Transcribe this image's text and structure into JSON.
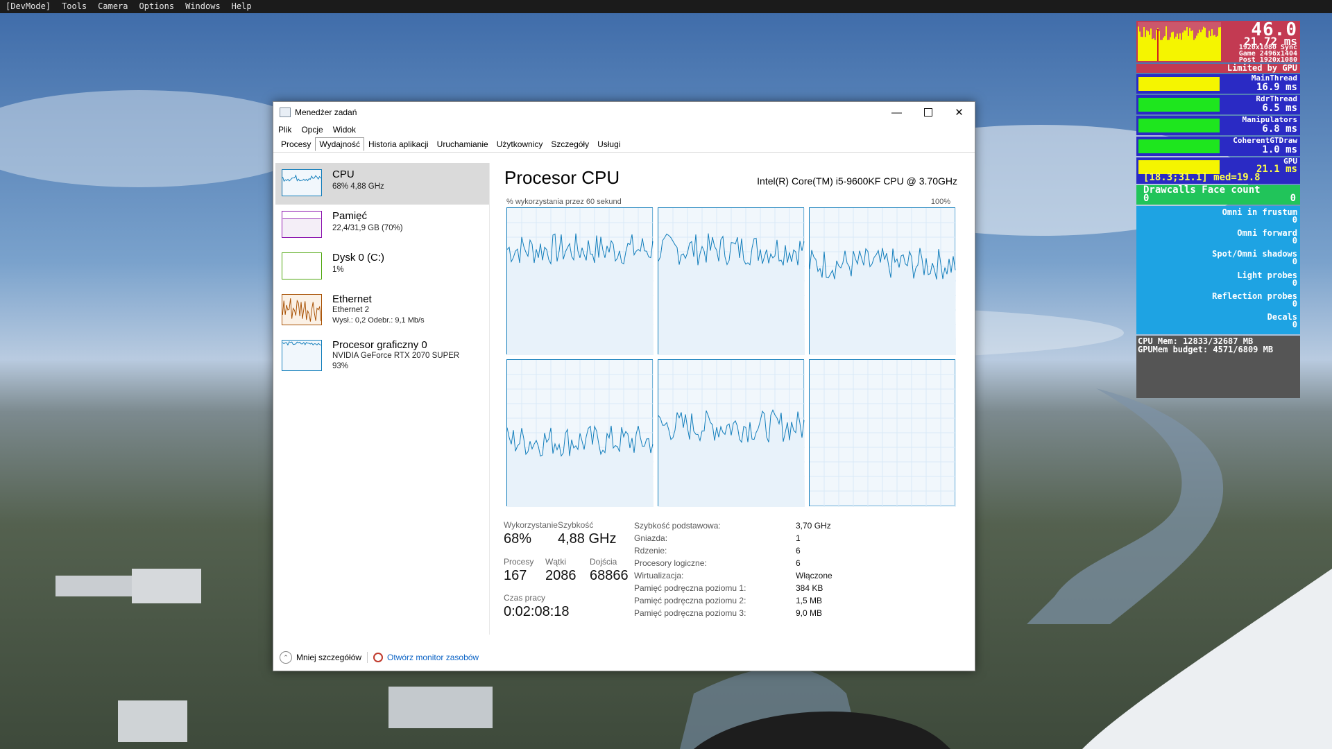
{
  "devmode_menu": [
    "[DevMode]",
    "Tools",
    "Camera",
    "Options",
    "Windows",
    "Help"
  ],
  "overlay": {
    "fps": "46.0",
    "frame_ms": "21.72 ms",
    "lines": [
      "1920x1080 Sync",
      "Game 2496x1404",
      "Post 1920x1080"
    ],
    "limited": "Limited by GPU",
    "threads": [
      {
        "name": "MainThread",
        "value": "16.9 ms",
        "fill": 1.0
      },
      {
        "name": "RdrThread",
        "value": "6.5 ms",
        "fill": 1.0
      },
      {
        "name": "Manipulators",
        "value": "6.8 ms",
        "fill": 1.0
      },
      {
        "name": "CoherentGTDraw",
        "value": "1.0 ms",
        "fill": 1.0
      }
    ],
    "gpu": {
      "name": "GPU",
      "value": "21.1 ms",
      "stats": "[18.3;31.1] med=19.8"
    },
    "drawcalls": {
      "label": "Drawcalls Face count",
      "v1": "0",
      "v2": "0"
    },
    "counters": [
      {
        "name": "Omni in frustum",
        "value": "0"
      },
      {
        "name": "Omni forward",
        "value": "0"
      },
      {
        "name": "Spot/Omni shadows",
        "value": "0"
      },
      {
        "name": "Light probes",
        "value": "0"
      },
      {
        "name": "Reflection probes",
        "value": "0"
      },
      {
        "name": "Decals",
        "value": "0"
      }
    ],
    "mem": [
      "CPU Mem: 12833/32687 MB",
      "GPUMem budget: 4571/6809 MB"
    ]
  },
  "window": {
    "title": "Menedżer zadań",
    "menu": [
      "Plik",
      "Opcje",
      "Widok"
    ],
    "tabs": [
      "Procesy",
      "Wydajność",
      "Historia aplikacji",
      "Uruchamianie",
      "Użytkownicy",
      "Szczegóły",
      "Usługi"
    ],
    "active_tab": "Wydajność",
    "left_items": [
      {
        "name": "CPU",
        "sub1": "68% 4,88 GHz",
        "color": "#117dbb"
      },
      {
        "name": "Pamięć",
        "sub1": "22,4/31,9 GB (70%)",
        "color": "#8b12ae"
      },
      {
        "name": "Dysk 0 (C:)",
        "sub1": "1%",
        "color": "#4da60c"
      },
      {
        "name": "Ethernet",
        "sub1": "Ethernet 2",
        "sub2": "Wysł.: 0,2 Odebr.: 9,1 Mb/s",
        "color": "#a74f01"
      },
      {
        "name": "Procesor graficzny 0",
        "sub1": "NVIDIA GeForce RTX 2070 SUPER",
        "sub2": "93%",
        "color": "#117dbb"
      }
    ],
    "cpu_panel": {
      "title": "Procesor CPU",
      "model": "Intel(R) Core(TM) i5-9600KF CPU @ 3.70GHz",
      "caption_left": "% wykorzystania przez 60 sekund",
      "caption_right": "100%",
      "core_levels": [
        0.72,
        0.72,
        0.62,
        0.45,
        0.55,
        0.0
      ],
      "stats": {
        "util_label": "Wykorzystanie",
        "util": "68%",
        "speed_label": "Szybkość",
        "speed": "4,88 GHz",
        "proc_label": "Procesy",
        "proc": "167",
        "threads_label": "Wątki",
        "threads": "2086",
        "handles_label": "Dojścia",
        "handles": "68866",
        "uptime_label": "Czas pracy",
        "uptime": "0:02:08:18"
      },
      "details": [
        {
          "k": "Szybkość podstawowa:",
          "v": "3,70 GHz"
        },
        {
          "k": "Gniazda:",
          "v": "1"
        },
        {
          "k": "Rdzenie:",
          "v": "6"
        },
        {
          "k": "Procesory logiczne:",
          "v": "6"
        },
        {
          "k": "Wirtualizacja:",
          "v": "Włączone"
        },
        {
          "k": "Pamięć podręczna poziomu 1:",
          "v": "384 KB"
        },
        {
          "k": "Pamięć podręczna poziomu 2:",
          "v": "1,5 MB"
        },
        {
          "k": "Pamięć podręczna poziomu 3:",
          "v": "9,0 MB"
        }
      ]
    },
    "bottom": {
      "less_details": "Mniej szczegółów",
      "resource_monitor": "Otwórz monitor zasobów"
    }
  }
}
